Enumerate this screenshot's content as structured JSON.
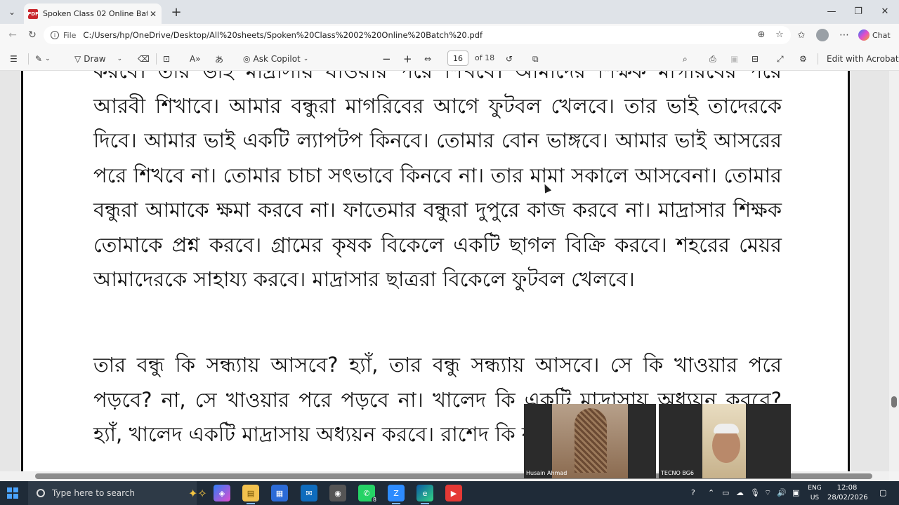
{
  "browser": {
    "tab_title": "Spoken Class 02 Online Batch .pdf",
    "file_label": "File",
    "url": "C:/Users/hp/OneDrive/Desktop/All%20sheets/Spoken%20Class%2002%20Online%20Batch%20.pdf",
    "chat_label": "Chat"
  },
  "pdf_toolbar": {
    "draw_label": "Draw",
    "copilot_label": "Ask Copilot",
    "page_current": "16",
    "page_total": "of 18",
    "edit_label": "Edit with Acrobat"
  },
  "document": {
    "paragraph1": "করবে। তার ভাই মাদ্রাসায় যাওয়ার পরে শিখবে। আমাদের শিক্ষক মাগরিবের পরে আরবী শিখাবে। আমার বন্ধুরা মাগরিবের আগে ফুটবল খেলবে। তার ভাই তাদেরকে দিবে। আমার ভাই একটি ল্যাপটপ কিনবে। তোমার বোন ভাঙ্গবে। আমার ভাই আসরের পরে শিখবে না। তোমার চাচা সৎভাবে কিনবে না। তার মামা সকালে আসবেনা। তোমার বন্ধুরা আমাকে ক্ষমা করবে না। ফাতেমার বন্ধুরা দুপুরে কাজ করবে না। মাদ্রাসার শিক্ষক তোমাকে প্রশ্ন করবে। গ্রামের কৃষক বিকেলে একটি ছাগল বিক্রি করবে। শহরের মেয়র আমাদেরকে সাহায্য করবে। মাদ্রাসার ছাত্ররা বিকেলে ফুটবল খেলবে।",
    "paragraph2": "তার বন্ধু কি সন্ধ্যায় আসবে? হ্যাঁ, তার বন্ধু সন্ধ্যায় আসবে। সে কি খাওয়ার পরে পড়বে? না, সে খাওয়ার পরে পড়বে না। খালেদ কি একটি মাদ্রাসায় অধ্যয়ন করবে? হ্যাঁ, খালেদ একটি মাদ্রাসায় অধ্যয়ন করবে। রাশেদ কি ফজরের পরে"
  },
  "video_call": {
    "participant1": "Husain Ahmad",
    "participant2": "TECNO BG6"
  },
  "taskbar": {
    "search_placeholder": "Type here to search",
    "whatsapp_badge": "8",
    "lang_line1": "ENG",
    "lang_line2": "US",
    "time": "12:08",
    "date": "28/02/2026"
  }
}
